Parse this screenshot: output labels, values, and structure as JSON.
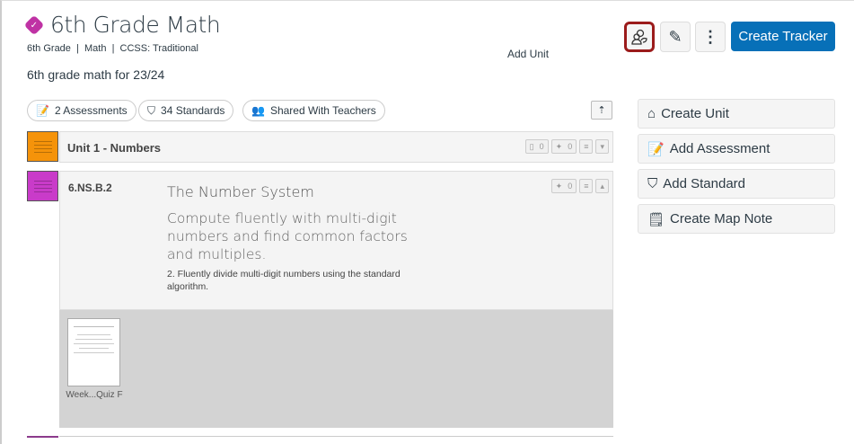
{
  "header": {
    "title": "6th Grade Math",
    "meta": "6th Grade  |  Math  |  CCSS: Traditional",
    "description": "6th grade math for 23/24",
    "tooltip": "Add Unit",
    "create_tracker": "Create Tracker"
  },
  "pills": [
    {
      "label": "2 Assessments"
    },
    {
      "label": "34 Standards"
    },
    {
      "label": "Shared With Teachers"
    }
  ],
  "sidebar": [
    {
      "label": "Create Unit"
    },
    {
      "label": "Add Assessment"
    },
    {
      "label": "Add Standard"
    },
    {
      "label": "Create Map Note"
    }
  ],
  "unit": {
    "title": "Unit 1 - Numbers",
    "doc_count": "0",
    "pin_count": "0",
    "color": "#f5930a"
  },
  "standard": {
    "code": "6.NS.B.2",
    "domain": "The Number System",
    "cluster": "Compute fluently with multi-digit numbers and find common factors and multiples.",
    "text": "2. Fluently divide multi-digit numbers using the standard algorithm.",
    "pin_count": "0",
    "color": "#c93bc9"
  },
  "assessment": {
    "name": "Week...Quiz F"
  },
  "colors": {
    "accent": "#0770b8",
    "badge": "#bf32a4",
    "highlight": "#9b1b1b"
  }
}
